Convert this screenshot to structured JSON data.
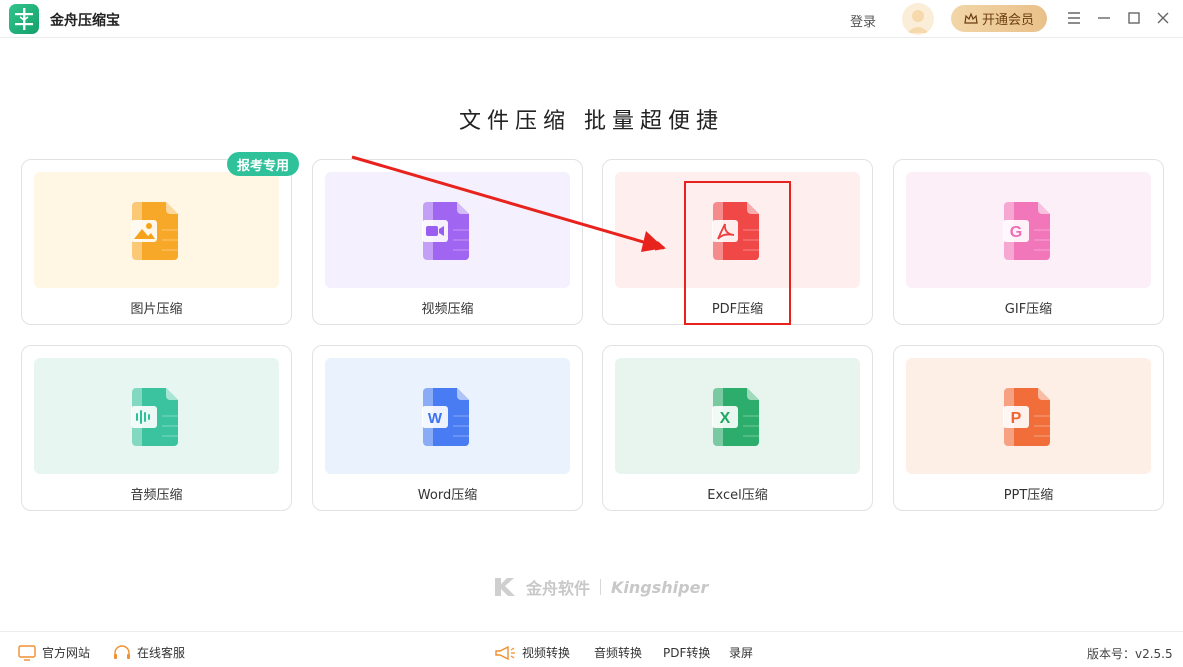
{
  "app": {
    "title": "金舟压缩宝"
  },
  "header": {
    "login_label": "登录",
    "vip_label": "开通会员"
  },
  "headline": "文件压缩  批量超便捷",
  "badge": "报考专用",
  "cards": [
    {
      "label": "图片压缩",
      "color": "#f7a21b",
      "bg": "#fff6e3",
      "icon": "image-file-icon"
    },
    {
      "label": "视频压缩",
      "color": "#9b5cf0",
      "bg": "#f4f0fd",
      "icon": "video-file-icon"
    },
    {
      "label": "PDF压缩",
      "color": "#ee3b3b",
      "bg": "#ffeeee",
      "icon": "pdf-file-icon"
    },
    {
      "label": "GIF压缩",
      "color": "#f06db5",
      "bg": "#fdeff8",
      "icon": "gif-file-icon"
    },
    {
      "label": "音频压缩",
      "color": "#2fc09a",
      "bg": "#e8f6f2",
      "icon": "audio-file-icon"
    },
    {
      "label": "Word压缩",
      "color": "#3d72f1",
      "bg": "#e9f2fd",
      "icon": "word-file-icon"
    },
    {
      "label": "Excel压缩",
      "color": "#1fa863",
      "bg": "#e8f4ee",
      "icon": "excel-file-icon"
    },
    {
      "label": "PPT压缩",
      "color": "#f0652f",
      "bg": "#fdeee6",
      "icon": "ppt-file-icon"
    }
  ],
  "watermark": {
    "brand": "金舟软件",
    "english": "Kingshiper"
  },
  "statusbar": {
    "official_site": "官方网站",
    "online_service": "在线客服",
    "video_convert": "视频转换",
    "audio_convert": "音频转换",
    "pdf_convert": "PDF转换",
    "screen_record": "录屏",
    "version": "版本号：v2.5.5"
  }
}
